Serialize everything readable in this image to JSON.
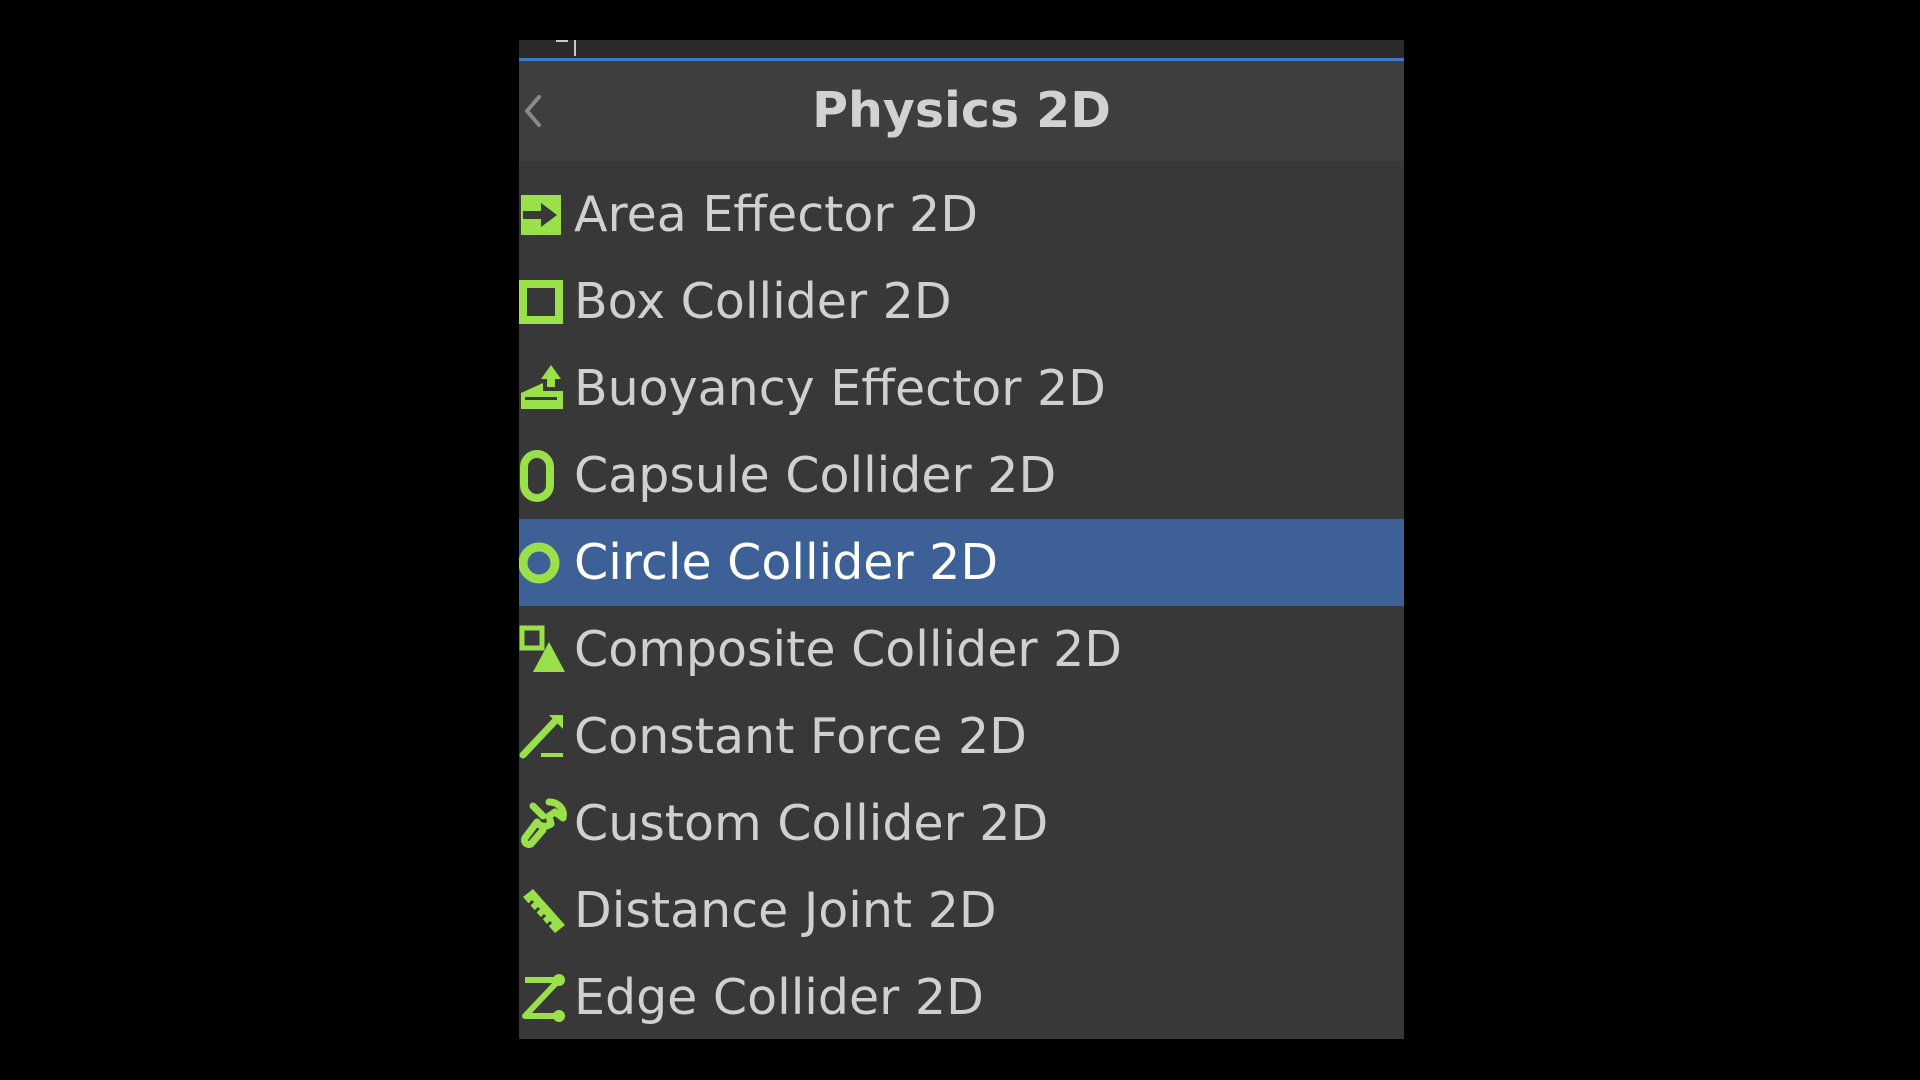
{
  "header": {
    "title": "Physics 2D",
    "back_icon": "chevron-left-icon"
  },
  "colors": {
    "background": "#000000",
    "panel": "#383838",
    "header": "#3e3e3e",
    "selection": "#3d6196",
    "search_underline": "#3a79c4",
    "icon_green": "#9ae04a",
    "text": "#d0d0d0"
  },
  "items": [
    {
      "label": "Area Effector 2D",
      "icon": "area-effector-icon",
      "selected": false
    },
    {
      "label": "Box Collider 2D",
      "icon": "box-collider-icon",
      "selected": false
    },
    {
      "label": "Buoyancy Effector 2D",
      "icon": "buoyancy-effector-icon",
      "selected": false
    },
    {
      "label": "Capsule Collider 2D",
      "icon": "capsule-collider-icon",
      "selected": false
    },
    {
      "label": "Circle Collider 2D",
      "icon": "circle-collider-icon",
      "selected": true
    },
    {
      "label": "Composite Collider 2D",
      "icon": "composite-collider-icon",
      "selected": false
    },
    {
      "label": "Constant Force 2D",
      "icon": "constant-force-icon",
      "selected": false
    },
    {
      "label": "Custom Collider 2D",
      "icon": "custom-collider-icon",
      "selected": false
    },
    {
      "label": "Distance Joint 2D",
      "icon": "distance-joint-icon",
      "selected": false
    },
    {
      "label": "Edge Collider 2D",
      "icon": "edge-collider-icon",
      "selected": false
    }
  ]
}
